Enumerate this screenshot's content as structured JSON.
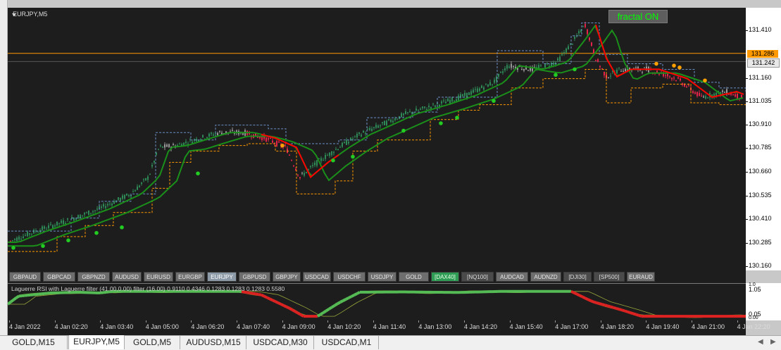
{
  "chart": {
    "symbol": "EURJPY,M5",
    "fractal_button": "fractal ON",
    "current_price": "131.286",
    "line_price": "131.242",
    "price_ticks": [
      "131.410",
      "131.286",
      "131.160",
      "131.035",
      "130.910",
      "130.785",
      "130.660",
      "130.535",
      "130.410",
      "130.285",
      "130.160"
    ],
    "colors": {
      "bull": "#2e8b57",
      "neutral": "#9a9a9a",
      "bear": "#e8234a",
      "green_line": "#1a8f1a",
      "red_line": "#ff0000",
      "fractal_up": "#ffa000",
      "fractal_down": "#22cc22",
      "envelope_upper": "#6a8fc8",
      "envelope_lower": "#ff9900",
      "current_line": "#ff9900"
    }
  },
  "symbol_bar": [
    {
      "label": "GBPAUD",
      "state": "normal"
    },
    {
      "label": "GBPCAD",
      "state": "normal"
    },
    {
      "label": "GBPNZD",
      "state": "normal"
    },
    {
      "label": "AUDUSD",
      "state": "normal"
    },
    {
      "label": "EURUSD",
      "state": "normal"
    },
    {
      "label": "EURGBP",
      "state": "normal"
    },
    {
      "label": "EURJPY",
      "state": "active"
    },
    {
      "label": "GBPUSD",
      "state": "normal"
    },
    {
      "label": "GBPJPY",
      "state": "normal"
    },
    {
      "label": "USDCAD",
      "state": "normal"
    },
    {
      "label": "USDCHF",
      "state": "normal"
    },
    {
      "label": "USDJPY",
      "state": "normal"
    },
    {
      "label": "GOLD",
      "state": "normal"
    },
    {
      "label": "[DAX40]",
      "state": "highlight"
    },
    {
      "label": "[NQ100]",
      "state": "index"
    },
    {
      "label": "AUDCAD",
      "state": "normal"
    },
    {
      "label": "AUDNZD",
      "state": "normal"
    },
    {
      "label": "[DJI30]",
      "state": "index"
    },
    {
      "label": "[SP500]",
      "state": "index"
    },
    {
      "label": "EURAUD",
      "state": "normal"
    }
  ],
  "indicator": {
    "label": "Laguerre RSI with Laguerre filter (41.00,0.00) filter (16.00) 0.9110 0.4346 0.1283 0.1283 0.1283 0.5580",
    "ticks": [
      "1.05",
      "0.05"
    ],
    "top_small": "1.0",
    "bottom_small": "0.00"
  },
  "time_axis": [
    "4 Jan 2022",
    "4 Jan 02:20",
    "4 Jan 03:40",
    "4 Jan 05:00",
    "4 Jan 06:20",
    "4 Jan 07:40",
    "4 Jan 09:00",
    "4 Jan 10:20",
    "4 Jan 11:40",
    "4 Jan 13:00",
    "4 Jan 14:20",
    "4 Jan 15:40",
    "4 Jan 17:00",
    "4 Jan 18:20",
    "4 Jan 19:40",
    "4 Jan 21:00",
    "4 Jan 22:20"
  ],
  "tabs": [
    {
      "label": "GOLD,M15",
      "active": false
    },
    {
      "label": "EURJPY,M5",
      "active": true
    },
    {
      "label": "GOLD,M5",
      "active": false
    },
    {
      "label": "AUDUSD,M15",
      "active": false
    },
    {
      "label": "USDCAD,M30",
      "active": false
    },
    {
      "label": "USDCAD,M1",
      "active": false
    }
  ]
}
